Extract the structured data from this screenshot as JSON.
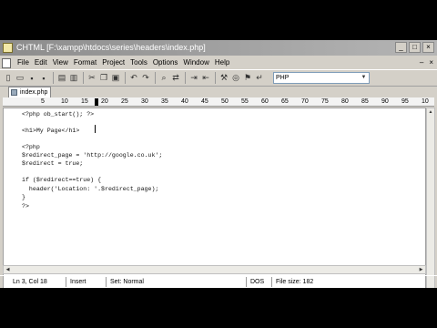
{
  "window": {
    "title": "CHTML [F:\\xampp\\htdocs\\series\\headers\\index.php]",
    "controls": [
      "_",
      "□",
      "×"
    ]
  },
  "menu": {
    "items": [
      "File",
      "Edit",
      "View",
      "Format",
      "Project",
      "Tools",
      "Options",
      "Window",
      "Help"
    ],
    "right_controls": [
      "–",
      "×"
    ]
  },
  "toolbar": {
    "language": "PHP",
    "icons": [
      "new-file-icon",
      "open-icon",
      "save-icon",
      "save-all-icon",
      "print-icon",
      "print-preview-icon",
      "cut-icon",
      "copy-icon",
      "paste-icon",
      "undo-icon",
      "redo-icon",
      "find-icon",
      "replace-icon",
      "indent-icon",
      "outdent-icon",
      "tool-icon",
      "browser-icon",
      "bookmark-icon",
      "wrap-icon"
    ]
  },
  "tabs": [
    {
      "label": "index.php"
    }
  ],
  "ruler": {
    "labels": [
      "5",
      "10",
      "15",
      "20",
      "25",
      "30",
      "35",
      "40",
      "45",
      "50",
      "55",
      "60",
      "65",
      "70",
      "75",
      "80",
      "85",
      "90",
      "95",
      "10"
    ]
  },
  "editor": {
    "lines": [
      "<?php ob_start(); ?>",
      "",
      "<h1>My Page</h1>",
      "",
      "<?php",
      "$redirect_page = 'http://google.co.uk';",
      "$redirect = true;",
      "",
      "if ($redirect==true) {",
      "  header('Location: '.$redirect_page);",
      "}",
      "?>"
    ]
  },
  "status": {
    "position": "Ln 3, Col 18",
    "mode": "Insert",
    "syntax": "Set: Normal",
    "line_ending": "DOS",
    "file_size": "File size: 182"
  }
}
